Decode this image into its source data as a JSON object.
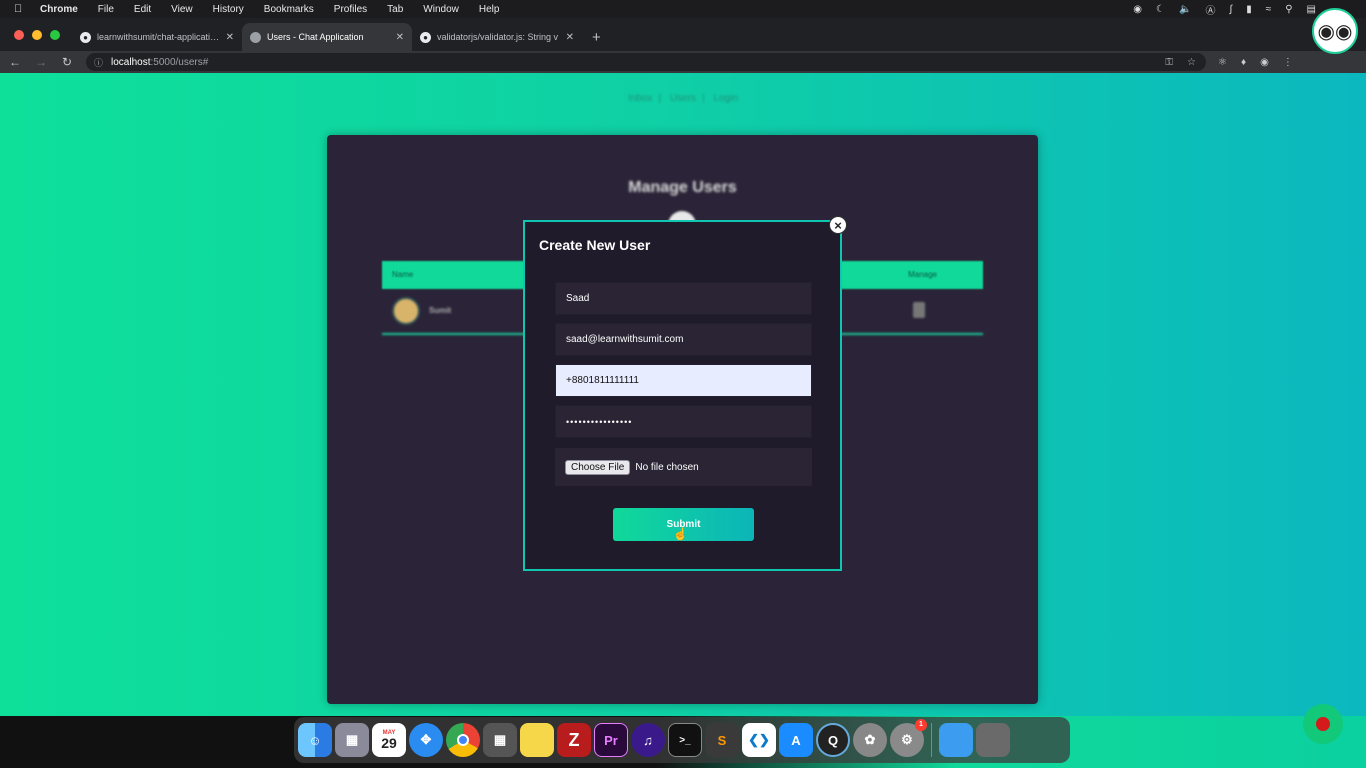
{
  "menubar": {
    "app": "Chrome",
    "items": [
      "File",
      "Edit",
      "View",
      "History",
      "Bookmarks",
      "Profiles",
      "Tab",
      "Window",
      "Help"
    ]
  },
  "tabs": [
    {
      "title": "learnwithsumit/chat-application",
      "icon": "github-icon",
      "active": false
    },
    {
      "title": "Users - Chat Application",
      "icon": "app-icon",
      "active": true
    },
    {
      "title": "validatorjs/validator.js: String v",
      "icon": "github-icon",
      "active": false
    }
  ],
  "address": {
    "host": "localhost",
    "path": ":5000/users#"
  },
  "page": {
    "nav": [
      "Inbox",
      "Users",
      "Login"
    ],
    "panel_title": "Manage Users",
    "table": {
      "headers": [
        "Name",
        "Manage"
      ],
      "rows": [
        {
          "name": "Sumit"
        }
      ]
    }
  },
  "modal": {
    "title": "Create New User",
    "close": "×",
    "fields": {
      "name": "Saad",
      "email": "saad@learnwithsumit.com",
      "mobile": "+8801811111111",
      "password": "••••••••••••••••"
    },
    "file_button": "Choose File",
    "file_status": "No file chosen",
    "submit": "Submit"
  },
  "dock": {
    "calendar_month": "MAY",
    "calendar_day": "29",
    "badge_count": "1",
    "apps": [
      "finder-icon",
      "launchpad-icon",
      "calendar-icon",
      "safari-icon",
      "chrome-icon",
      "calculator-icon",
      "notes-icon",
      "filezilla-icon",
      "premiere-icon",
      "audition-icon",
      "terminal-icon",
      "sublime-icon",
      "vscode-icon",
      "appstore-icon",
      "quicktime-icon",
      "photo-slideshow-icon",
      "system-preferences-icon",
      "folder-icon",
      "trash-icon"
    ]
  },
  "colors": {
    "accent": "#10d99a",
    "panel": "#2b2438",
    "modal_border": "#0fc6b0"
  }
}
